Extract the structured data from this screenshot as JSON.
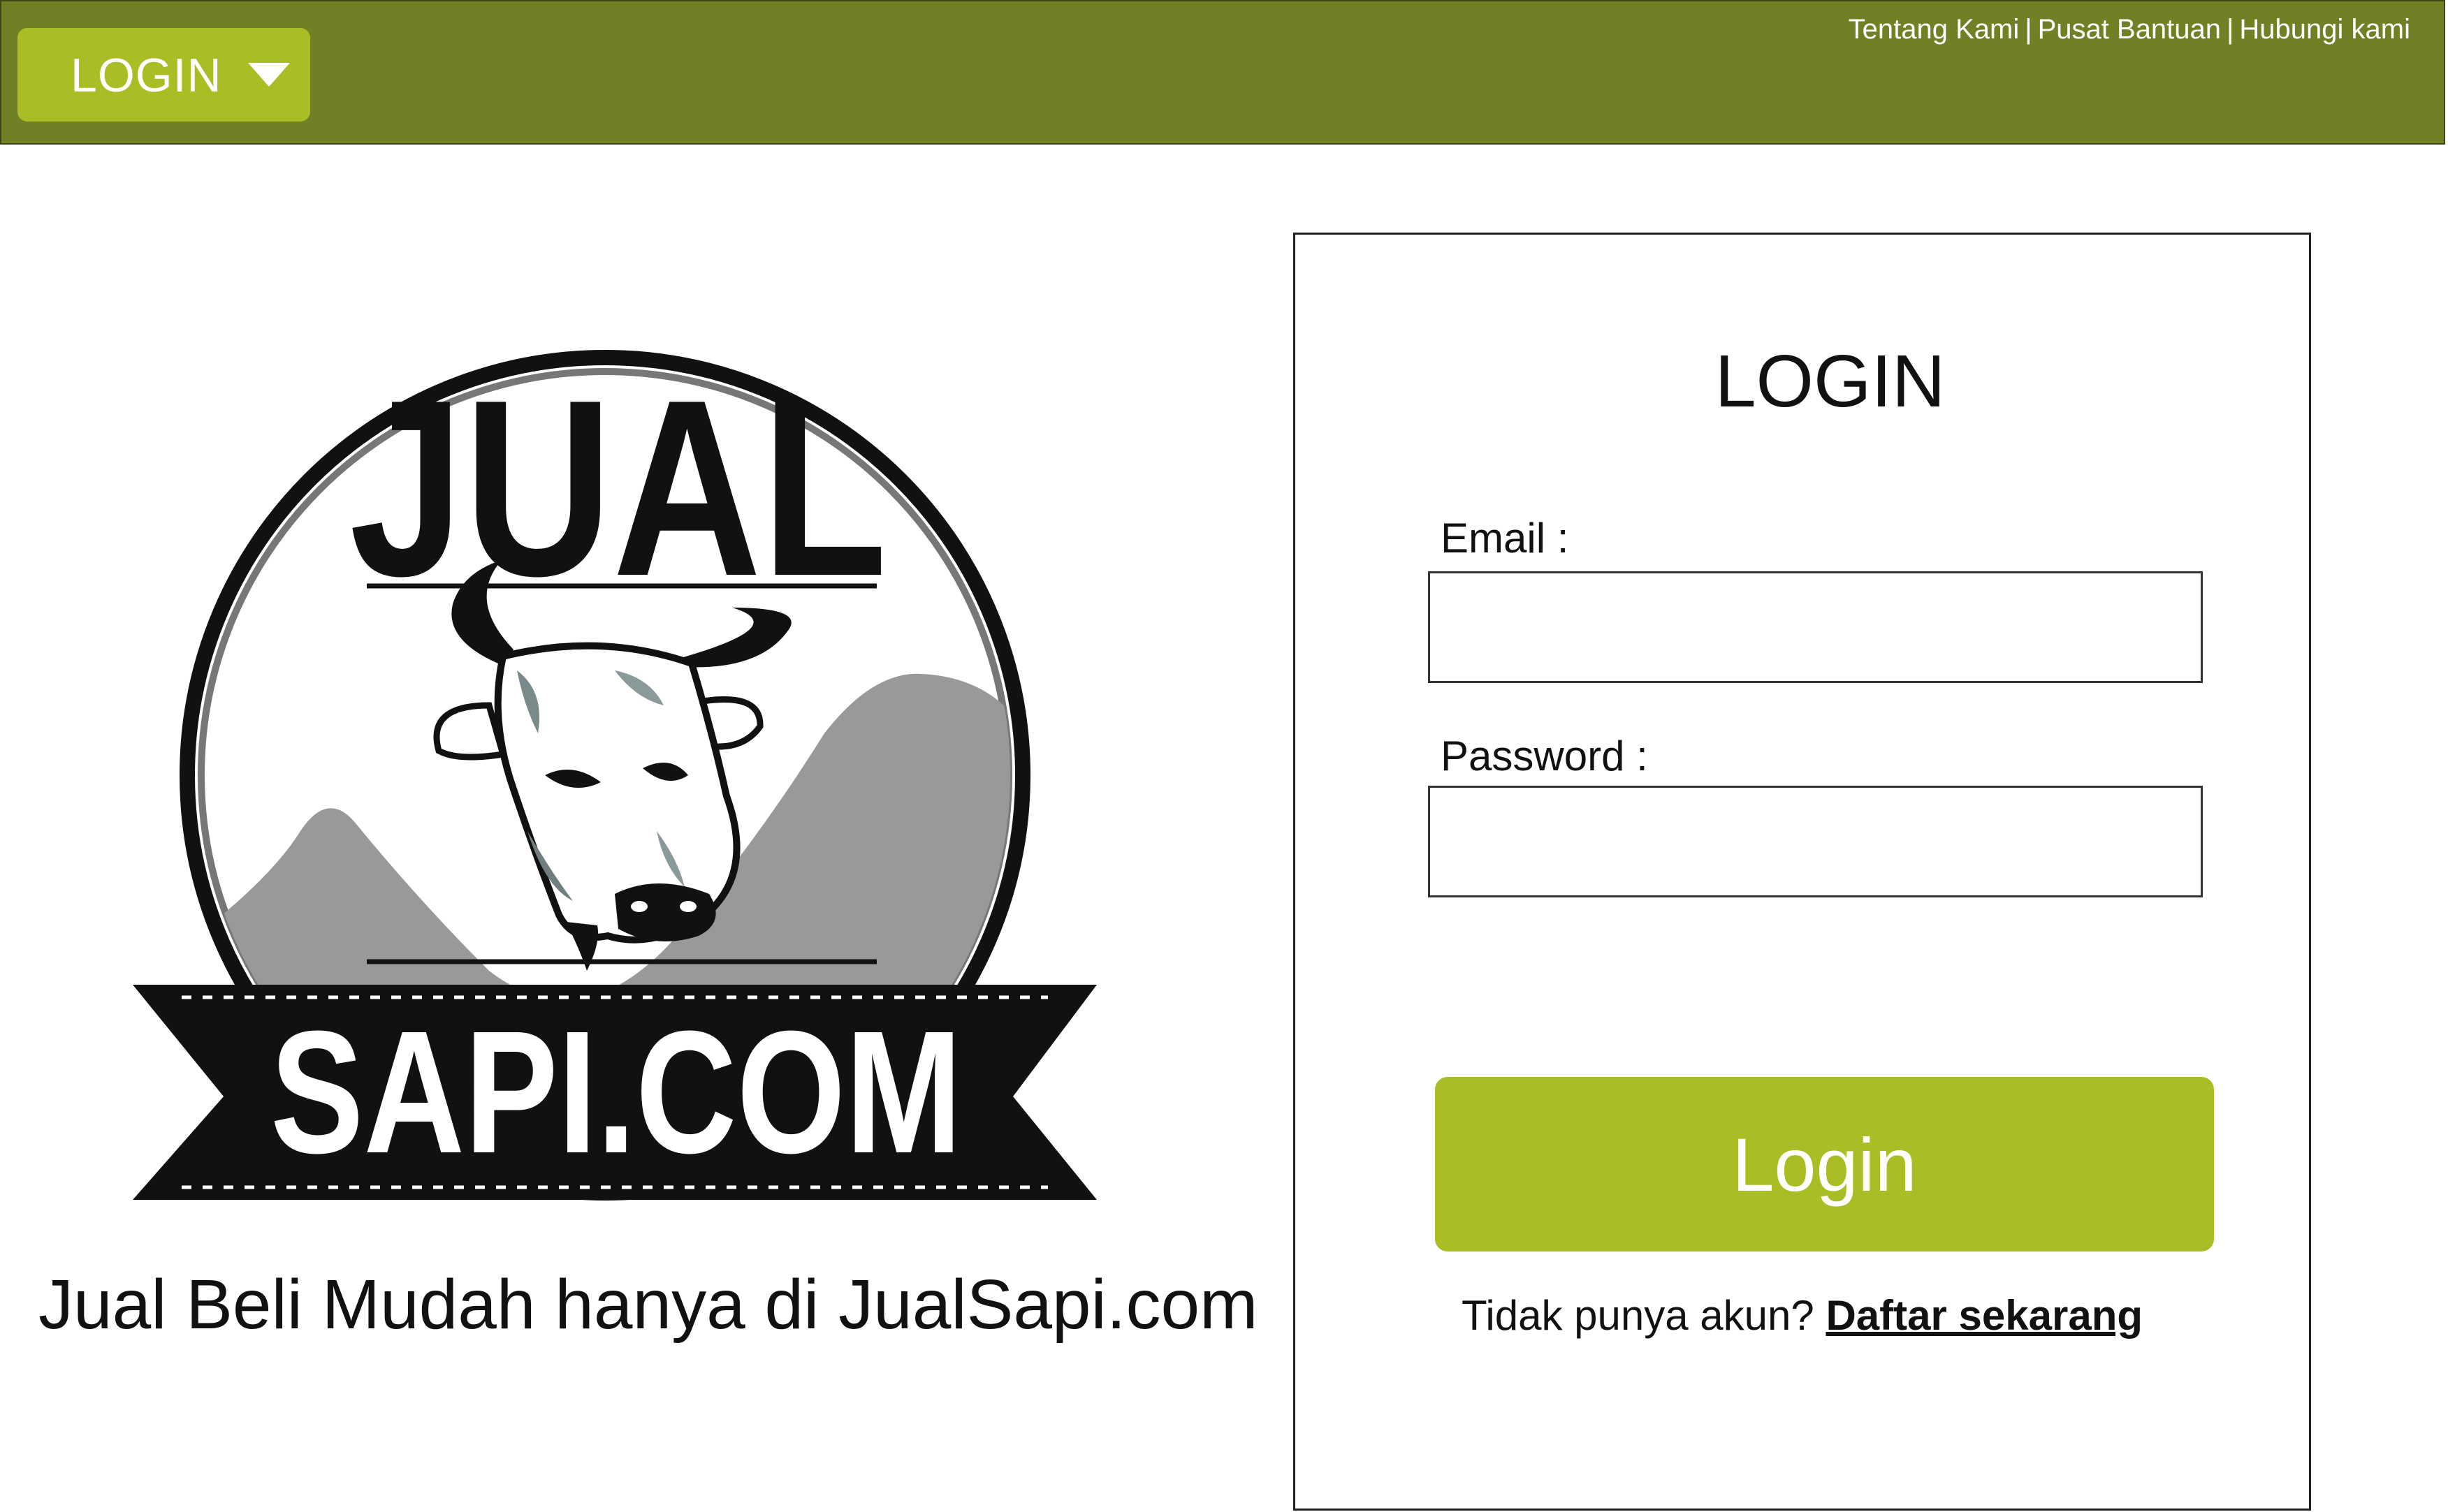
{
  "colors": {
    "topbar": "#718024",
    "accent": "#abbd25",
    "text": "#111111",
    "logo_black": "#111111",
    "logo_mountain": "#999999"
  },
  "topbar": {
    "menu_label": "LOGIN",
    "menu_icon": "caret-down-icon",
    "links": [
      "Tentang Kami",
      "Pusat Bantuan",
      "Hubungi kami"
    ],
    "separator": "|"
  },
  "logo": {
    "top_word": "JUAL",
    "banner_word": "SAPI.COM",
    "emblem": "cow-head-icon"
  },
  "tagline": "Jual Beli Mudah hanya di JualSapi.com",
  "login_form": {
    "title": "LOGIN",
    "email_label": "Email :",
    "email_value": "",
    "password_label": "Password :",
    "password_value": "",
    "submit_label": "Login",
    "register_prompt": "Tidak punya akun?",
    "register_link": "Daftar sekarang"
  }
}
